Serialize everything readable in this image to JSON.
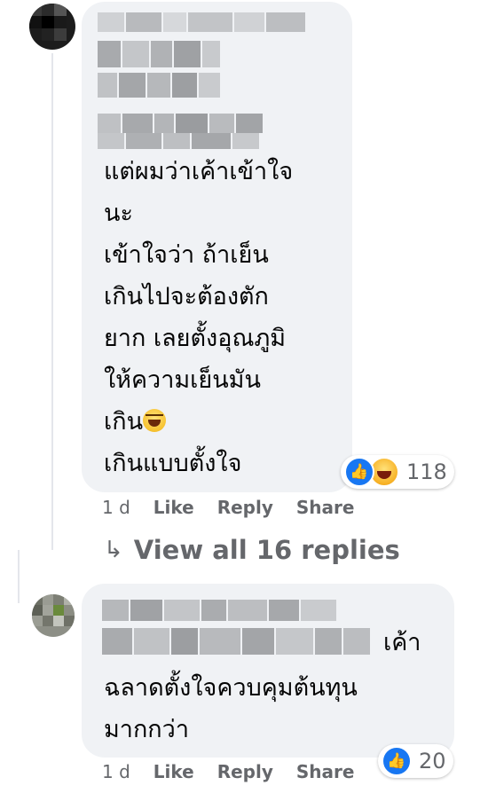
{
  "comment1": {
    "text": "แต่ผมว่าเค้าเข้าใจ\nนะ\nเข้าใจว่า ถ้าเย็น\nเกินไปจะต้องตัก\nยาก เลยตั้งอุณภูมิ\nให้ความเย็นมัน\nเกิน",
    "text_end": "เกินแบบตั้งใจ",
    "emoji": "laughing-crying-emoji",
    "reactions": [
      "like",
      "haha"
    ],
    "reaction_count": "118",
    "time": "1 d",
    "like_label": "Like",
    "reply_label": "Reply",
    "share_label": "Share"
  },
  "view_replies": {
    "arrow": "↳",
    "label": "View all 16 replies"
  },
  "comment2": {
    "inline_text": "เค้า",
    "text": "ฉลาดตั้งใจควบคุมต้นทุน\nมากกว่า",
    "reactions": [
      "like"
    ],
    "reaction_count": "20",
    "time": "1 d",
    "like_label": "Like",
    "reply_label": "Reply",
    "share_label": "Share"
  },
  "colors": {
    "bubble": "#f0f2f5",
    "secondary_text": "#65676b",
    "like_blue": "#1877f2"
  }
}
